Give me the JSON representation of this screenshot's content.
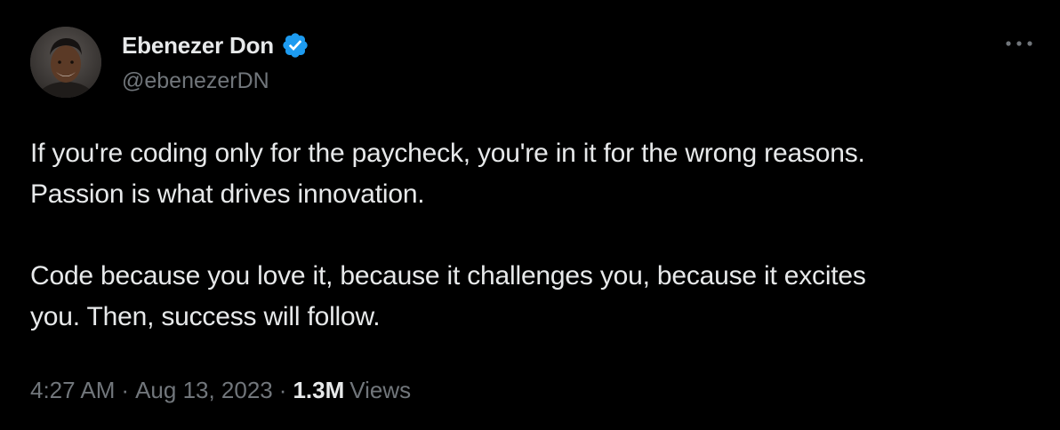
{
  "author": {
    "display_name": "Ebenezer Don",
    "handle": "@ebenezerDN",
    "verified": true,
    "avatar": "avatar-photo"
  },
  "tweet": {
    "paragraphs": [
      "If you're coding only for the paycheck, you're in it for the wrong reasons.\nPassion is what drives innovation.",
      "Code because you love it, because it challenges you, because it excites\nyou. Then, success will follow."
    ],
    "time": "4:27 AM",
    "separator": "·",
    "date": "Aug 13, 2023",
    "views_count": "1.3M",
    "views_label": "Views"
  },
  "icons": {
    "verified": "verified-badge-icon",
    "more": "more-options-icon"
  },
  "colors": {
    "background": "#000000",
    "text_primary": "#e7e9ea",
    "text_secondary": "#71767b",
    "verified_blue": "#1d9bf0"
  }
}
